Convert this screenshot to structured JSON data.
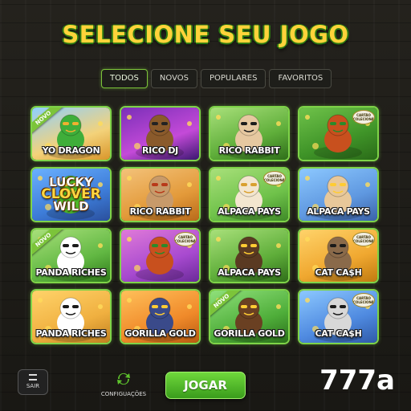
{
  "title": "SELECIONE SEU JOGO",
  "tabs": [
    "TODOS",
    "NOVOS",
    "POPULARES",
    "FAVORITOS"
  ],
  "active_tab": "TODOS",
  "games": [
    {
      "name": "YO DRAGON",
      "ribbon": "NOVO",
      "badge": "",
      "theme": "dragon"
    },
    {
      "name": "RICO DJ",
      "ribbon": "",
      "badge": "",
      "theme": "dj"
    },
    {
      "name": "RICO RABBIT",
      "ribbon": "",
      "badge": "",
      "theme": "rabbit"
    },
    {
      "name": "",
      "ribbon": "",
      "badge": "CARTÃO COLECIONÁVEL",
      "theme": "leprechaun"
    },
    {
      "name": "",
      "ribbon": "",
      "badge": "",
      "theme": "clover",
      "logo_lines": [
        "LUCKY",
        "CLOVER",
        "WILD"
      ]
    },
    {
      "name": "RICO RABBIT",
      "ribbon": "",
      "badge": "",
      "theme": "rabbit2"
    },
    {
      "name": "ALPACA PAYS",
      "ribbon": "",
      "badge": "CARTÃO COLECIONÁVEL",
      "theme": "alpaca"
    },
    {
      "name": "ALPACA PAYS",
      "ribbon": "",
      "badge": "",
      "theme": "alpaca2"
    },
    {
      "name": "PANDA RICHES",
      "ribbon": "NOVO",
      "badge": "",
      "theme": "panda"
    },
    {
      "name": "",
      "ribbon": "",
      "badge": "CARTÃO COLECIONÁVEL",
      "theme": "leprechaun2"
    },
    {
      "name": "ALPACA PAYS",
      "ribbon": "",
      "badge": "",
      "theme": "gorilla"
    },
    {
      "name": "CAT CA$H",
      "ribbon": "",
      "badge": "CARTÃO COLECIONÁVEL",
      "theme": "cat"
    },
    {
      "name": "PANDA RICHES",
      "ribbon": "",
      "badge": "",
      "theme": "panda2"
    },
    {
      "name": "GORILLA GOLD",
      "ribbon": "",
      "badge": "",
      "theme": "gorilla2"
    },
    {
      "name": "GORILLA GOLD",
      "ribbon": "NOVO",
      "badge": "",
      "theme": "gorilla3"
    },
    {
      "name": "CAT CA$H",
      "ribbon": "",
      "badge": "CARTÃO COLECIONÁVEL",
      "theme": "cat2"
    }
  ],
  "buttons": {
    "exit": "SAIR",
    "settings": "CONFIGUAÇÕES",
    "play": "JOGAR"
  },
  "brand": "777a",
  "colors": {
    "accent": "#7ed348",
    "title_gold": "#ffd33a",
    "play_green": "#4fb82a"
  }
}
